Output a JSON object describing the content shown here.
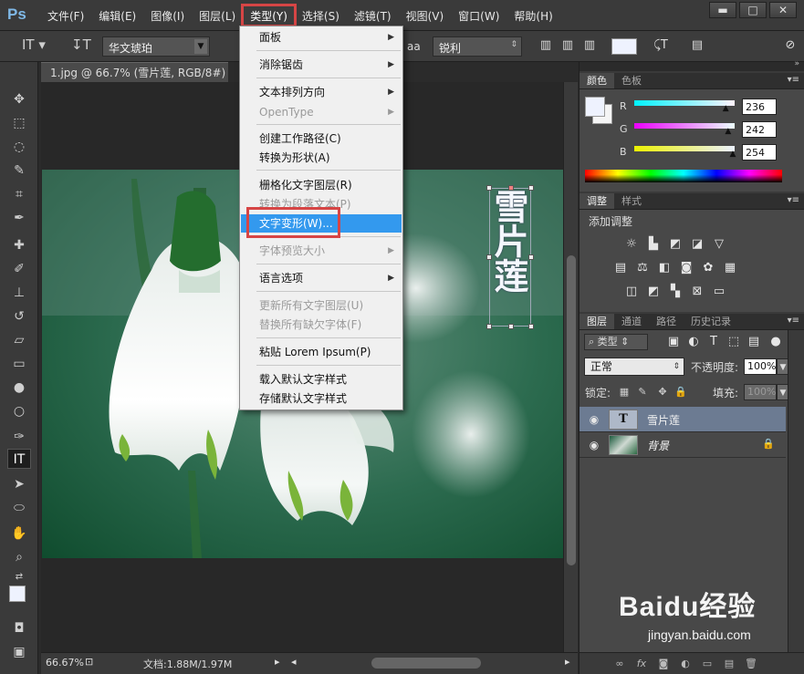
{
  "app": {
    "logo": "Ps"
  },
  "menubar": [
    {
      "label": "文件(F)"
    },
    {
      "label": "编辑(E)"
    },
    {
      "label": "图像(I)"
    },
    {
      "label": "图层(L)"
    },
    {
      "label": "类型(Y)"
    },
    {
      "label": "选择(S)"
    },
    {
      "label": "滤镜(T)"
    },
    {
      "label": "视图(V)"
    },
    {
      "label": "窗口(W)"
    },
    {
      "label": "帮助(H)"
    }
  ],
  "window_buttons": {
    "minimize": "▬",
    "maximize": "□",
    "close": "✕"
  },
  "options": {
    "font_family": "华文琥珀",
    "aa_label": "a",
    "antialias": "锐利"
  },
  "document": {
    "tab_title": "1.jpg @ 66.7% (雪片莲, RGB/8#) *",
    "zoom": "66.67%",
    "doc_size": "文档:1.88M/1.97M",
    "vertical_text": "雪片莲"
  },
  "type_menu": {
    "items": [
      {
        "label": "面板",
        "submenu": true,
        "disabled": false
      },
      {
        "label": "消除锯齿",
        "submenu": true,
        "disabled": false
      },
      {
        "label": "文本排列方向",
        "submenu": true,
        "disabled": false
      },
      {
        "label": "OpenType",
        "submenu": true,
        "disabled": true
      },
      {
        "label": "创建工作路径(C)",
        "submenu": false,
        "disabled": false
      },
      {
        "label": "转换为形状(A)",
        "submenu": false,
        "disabled": false
      },
      {
        "label": "栅格化文字图层(R)",
        "submenu": false,
        "disabled": false
      },
      {
        "label": "转换为段落文本(P)",
        "submenu": false,
        "disabled": true
      },
      {
        "label": "文字变形(W)...",
        "submenu": false,
        "disabled": false,
        "highlight": true
      },
      {
        "label": "字体预览大小",
        "submenu": true,
        "disabled": true
      },
      {
        "label": "语言选项",
        "submenu": true,
        "disabled": false
      },
      {
        "label": "更新所有文字图层(U)",
        "submenu": false,
        "disabled": true
      },
      {
        "label": "替换所有缺欠字体(F)",
        "submenu": false,
        "disabled": true
      },
      {
        "label": "粘贴 Lorem Ipsum(P)",
        "submenu": false,
        "disabled": false
      },
      {
        "label": "载入默认文字样式",
        "submenu": false,
        "disabled": false
      },
      {
        "label": "存储默认文字样式",
        "submenu": false,
        "disabled": false
      }
    ]
  },
  "color_panel": {
    "tabs": [
      "颜色",
      "色板"
    ],
    "r_label": "R",
    "g_label": "G",
    "b_label": "B",
    "r": "236",
    "g": "242",
    "b": "254",
    "r_fraction": 0.925,
    "g_fraction": 0.949,
    "b_fraction": 0.996,
    "fg_color": "#eef2fe"
  },
  "adjustments_panel": {
    "tabs": [
      "调整",
      "样式"
    ],
    "title": "添加调整"
  },
  "layers_panel": {
    "tabs": [
      "图层",
      "通道",
      "路径",
      "历史记录"
    ],
    "filter": "类型",
    "blend_mode": "正常",
    "opacity_label": "不透明度:",
    "opacity": "100%",
    "lock_label": "锁定:",
    "fill_label": "填充:",
    "fill": "100%",
    "layers": [
      {
        "name": "雪片莲",
        "thumb": "T",
        "selected": true
      },
      {
        "name": "背景",
        "selected": false,
        "locked": true
      }
    ]
  },
  "watermark": {
    "brand": "Baidu经验",
    "url": "jingyan.baidu.com"
  },
  "colors": {
    "accent_red": "#d64545",
    "menu_highlight": "#3399ee",
    "foreground": "#eef2fe"
  }
}
